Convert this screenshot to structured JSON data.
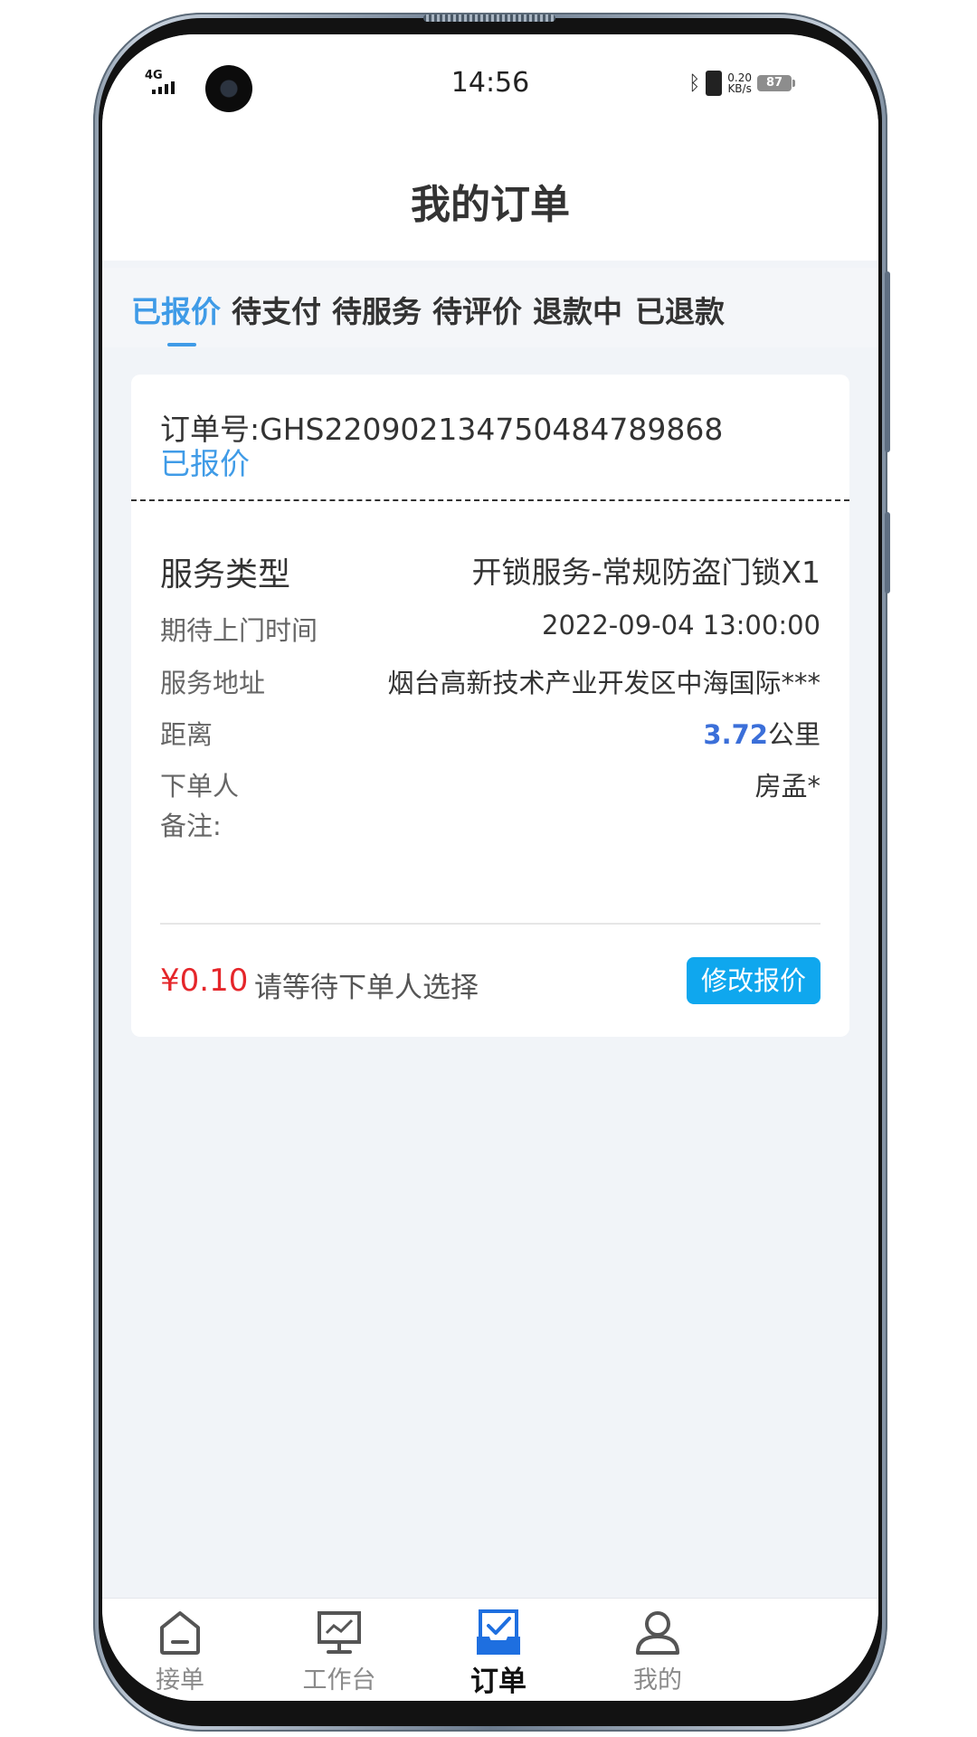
{
  "status_bar": {
    "network": "4G",
    "time": "14:56",
    "speed_value": "0.20",
    "speed_unit": "KB/s",
    "battery": "87",
    "icons": [
      "signal-icon",
      "camera-cutout",
      "bluetooth-icon",
      "vibrate-icon",
      "battery-icon"
    ]
  },
  "header": {
    "title": "我的订单"
  },
  "tabs": [
    {
      "label": "已报价",
      "active": true
    },
    {
      "label": "待支付"
    },
    {
      "label": "待服务"
    },
    {
      "label": "待评价"
    },
    {
      "label": "退款中"
    },
    {
      "label": "已退款"
    }
  ],
  "order": {
    "number": "订单号:GHS22090213475048478986​8",
    "status": "已报价",
    "service_type_label": "服务类型",
    "service_type_value": "开锁服务-常规防盗门锁X1",
    "time_label": "期待上门时间",
    "time_value": "2022-09-04 13:00:00",
    "address_label": "服务地址",
    "address_value": "烟台高新技术产业开发区中海国际***",
    "distance_label": "距离",
    "distance_value": "3.72",
    "distance_unit": "公里",
    "customer_label": "下单人",
    "customer_value": "房孟*",
    "remark_label": "备注:",
    "price": "¥0.10",
    "price_note": "请等待下单人选择",
    "modify_button": "修改报价"
  },
  "bottom_nav": [
    {
      "label": "接单",
      "icon": "home-icon"
    },
    {
      "label": "工作台",
      "icon": "monitor-icon"
    },
    {
      "label": "订单",
      "icon": "order-check-icon",
      "active": true
    },
    {
      "label": "我的",
      "icon": "user-icon"
    }
  ],
  "colors": {
    "accent": "#3f9be7",
    "button": "#0fa7ee",
    "price": "#e5262a",
    "distance": "#3b6fd9",
    "nav_active": "#1e6fe0"
  }
}
